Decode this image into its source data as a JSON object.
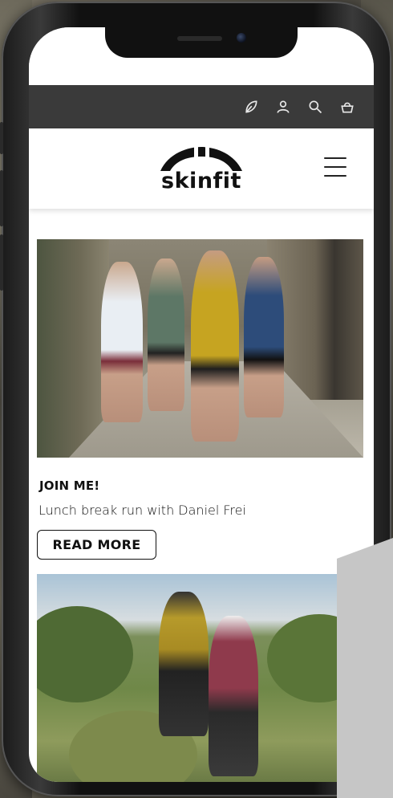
{
  "topbar": {
    "icons": [
      "leaf-icon",
      "user-icon",
      "search-icon",
      "basket-icon"
    ]
  },
  "brand": {
    "logo_text": "skinfit"
  },
  "posts": [
    {
      "title": "JOIN ME!",
      "subtitle": "Lunch break run with Daniel Frei",
      "button_label": "READ MORE"
    }
  ],
  "colors": {
    "topbar_bg": "#3a3a3a",
    "text": "#111111",
    "accent_gray": "#c6c6c6"
  }
}
